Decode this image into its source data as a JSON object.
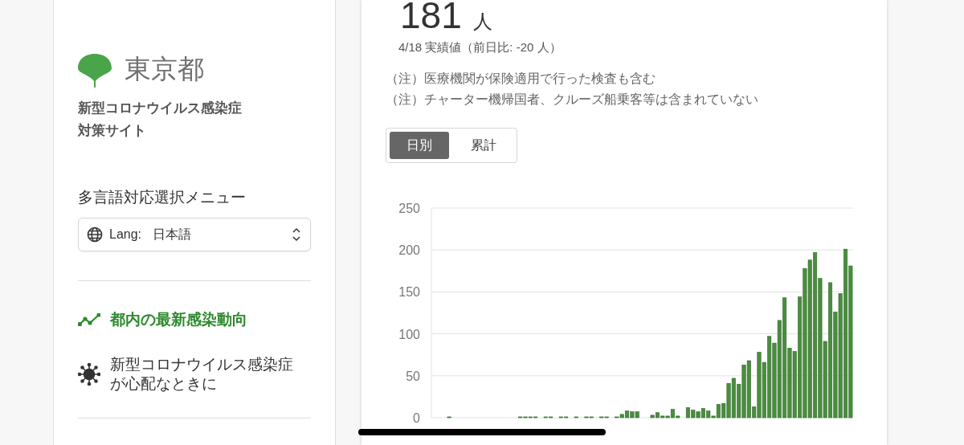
{
  "sidebar": {
    "logo_text": "東京都",
    "site_title": "新型コロナウイルス感染症対策サイト",
    "language_menu_label": "多言語対応選択メニュー",
    "language_select": {
      "prefix": "Lang:",
      "value": "日本語"
    },
    "nav_items": [
      {
        "label": "都内の最新感染動向",
        "kind": "trend",
        "selected": true
      },
      {
        "label": "新型コロナウイルス感染症が心配なときに",
        "kind": "virus",
        "selected": false
      }
    ]
  },
  "main": {
    "count": "181",
    "unit": "人",
    "date_note": "4/18 実績値（前日比: -20 人）",
    "notes": [
      "（注）医療機関が保険適用で行った検査も含む",
      "（注）チャーター機帰国者、クルーズ船乗客等は含まれていない"
    ],
    "tabs": [
      {
        "label": "日別",
        "selected": true
      },
      {
        "label": "累計",
        "selected": false
      }
    ],
    "chart_data": {
      "type": "bar",
      "grid": true,
      "ylim": [
        0,
        250
      ],
      "yticks": [
        0,
        50,
        100,
        150,
        200,
        250
      ],
      "series": [
        {
          "color": "#4b8d3f",
          "values": [
            0,
            0,
            0,
            1,
            0,
            0,
            0,
            0,
            0,
            0,
            0,
            0,
            0,
            0,
            0,
            0,
            0,
            1,
            1,
            1,
            1,
            0,
            1,
            1,
            0,
            1,
            1,
            0,
            1,
            0,
            1,
            1,
            0,
            1,
            1,
            0,
            1,
            4,
            8,
            7,
            7,
            0,
            0,
            3,
            6,
            2,
            2,
            10,
            2,
            0,
            12,
            9,
            7,
            11,
            8,
            2,
            16,
            17,
            41,
            47,
            40,
            63,
            68,
            13,
            78,
            66,
            97,
            89,
            116,
            143,
            83,
            79,
            144,
            178,
            188,
            197,
            166,
            91,
            161,
            126,
            148,
            201,
            181
          ]
        }
      ]
    }
  }
}
